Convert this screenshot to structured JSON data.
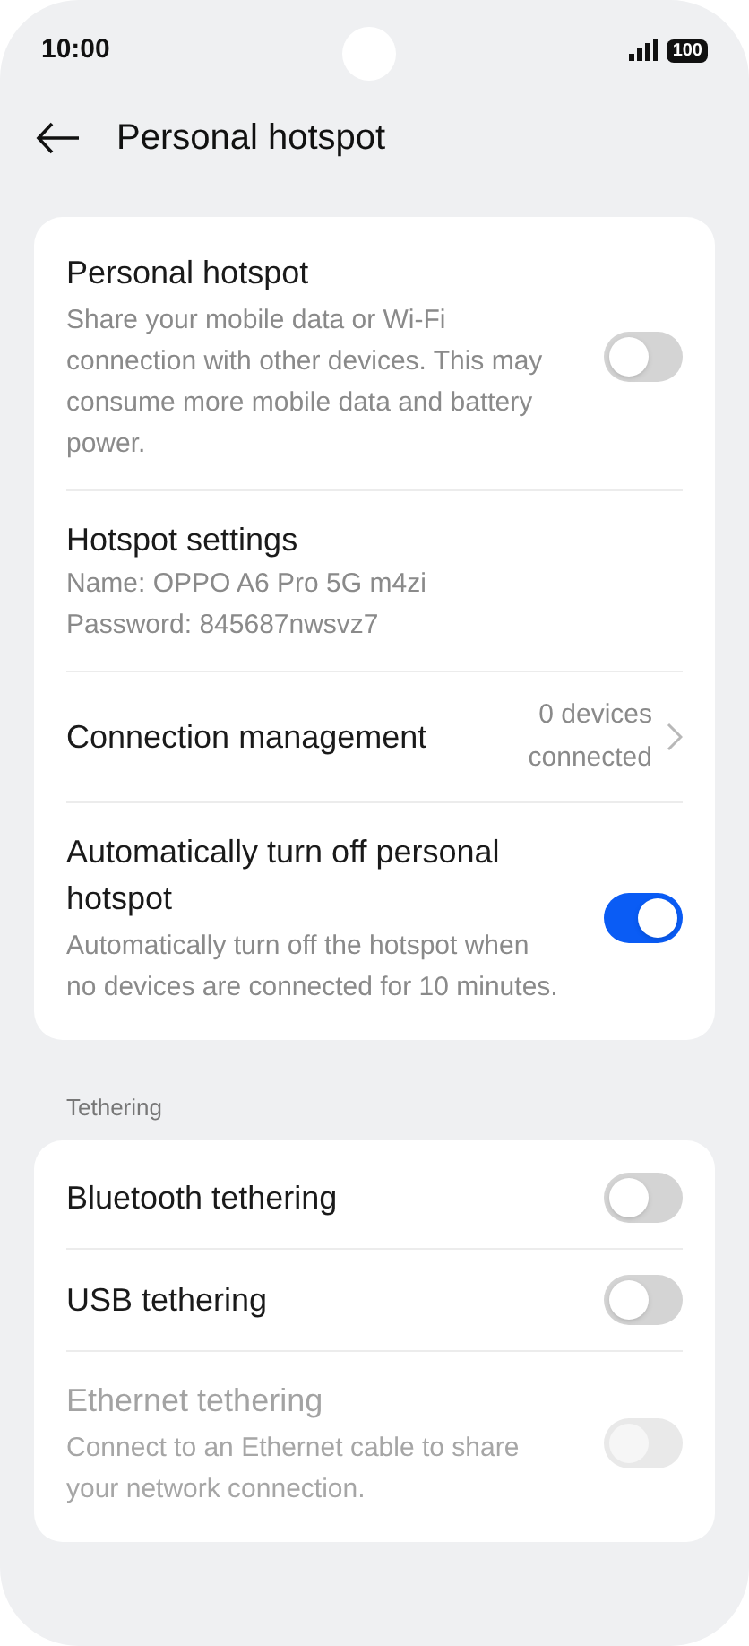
{
  "status_bar": {
    "time": "10:00",
    "battery": "100"
  },
  "header": {
    "title": "Personal hotspot"
  },
  "sections": [
    {
      "items": [
        {
          "kind": "toggle",
          "title": "Personal hotspot",
          "subtitle": "Share your mobile data or Wi-Fi connection with other devices. This may consume more mobile data and battery power.",
          "on": false,
          "disabled": false
        },
        {
          "kind": "info",
          "title": "Hotspot settings",
          "lines": [
            "Name: OPPO A6 Pro 5G m4zi",
            "Password: 845687nwsvz7"
          ]
        },
        {
          "kind": "link",
          "title": "Connection management",
          "value": "0 devices connected"
        },
        {
          "kind": "toggle",
          "title": "Automatically turn off personal hotspot",
          "subtitle": "Automatically turn off the hotspot when no devices are connected for 10 minutes.",
          "on": true,
          "disabled": false
        }
      ]
    },
    {
      "heading": "Tethering",
      "items": [
        {
          "kind": "toggle",
          "title": "Bluetooth tethering",
          "on": false,
          "disabled": false
        },
        {
          "kind": "toggle",
          "title": "USB tethering",
          "on": false,
          "disabled": false
        },
        {
          "kind": "toggle",
          "title": "Ethernet tethering",
          "subtitle": "Connect to an Ethernet cable to share your network connection.",
          "on": false,
          "disabled": true
        }
      ]
    }
  ]
}
